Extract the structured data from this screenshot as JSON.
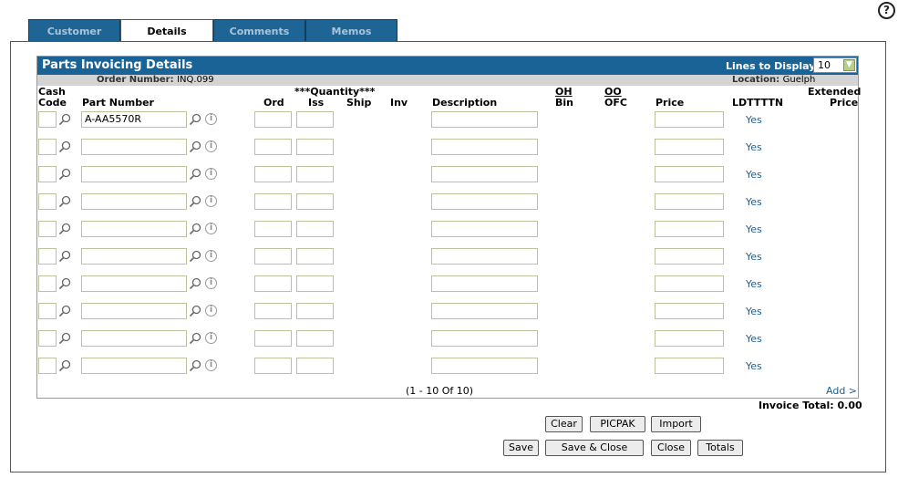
{
  "tabs": [
    "Customer",
    "Details",
    "Comments",
    "Memos"
  ],
  "help_label": "?",
  "panel": {
    "title": "Parts Invoicing Details",
    "lines_label": "Lines to Display:",
    "lines_value": "10",
    "order_label": "Order Number:",
    "order_value": "INQ.099",
    "location_label": "Location:",
    "location_value": "Guelph"
  },
  "headers": {
    "cash": "Cash",
    "code": "Code",
    "part_number": "Part Number",
    "quantity": "***Quantity***",
    "ord": "Ord",
    "iss": "Iss",
    "ship": "Ship",
    "inv": "Inv",
    "description": "Description",
    "oh": "OH",
    "bin": "Bin",
    "oo": "OO",
    "ofc": "OFC",
    "price": "Price",
    "ldtttn": "LDTTTTN",
    "extended": "Extended",
    "ext_price": "Price"
  },
  "rows": [
    {
      "part": "A-AA5570R",
      "ldtttn": "Yes"
    },
    {
      "part": "",
      "ldtttn": "Yes"
    },
    {
      "part": "",
      "ldtttn": "Yes"
    },
    {
      "part": "",
      "ldtttn": "Yes"
    },
    {
      "part": "",
      "ldtttn": "Yes"
    },
    {
      "part": "",
      "ldtttn": "Yes"
    },
    {
      "part": "",
      "ldtttn": "Yes"
    },
    {
      "part": "",
      "ldtttn": "Yes"
    },
    {
      "part": "",
      "ldtttn": "Yes"
    },
    {
      "part": "",
      "ldtttn": "Yes"
    }
  ],
  "pager": "(1 - 10 Of 10)",
  "add_link": "Add >",
  "invoice_total": "Invoice Total: 0.00",
  "buttons": {
    "clear": "Clear",
    "picpak": "PICPAK",
    "import": "Import",
    "save": "Save",
    "save_close": "Save & Close",
    "close": "Close",
    "totals": "Totals"
  }
}
